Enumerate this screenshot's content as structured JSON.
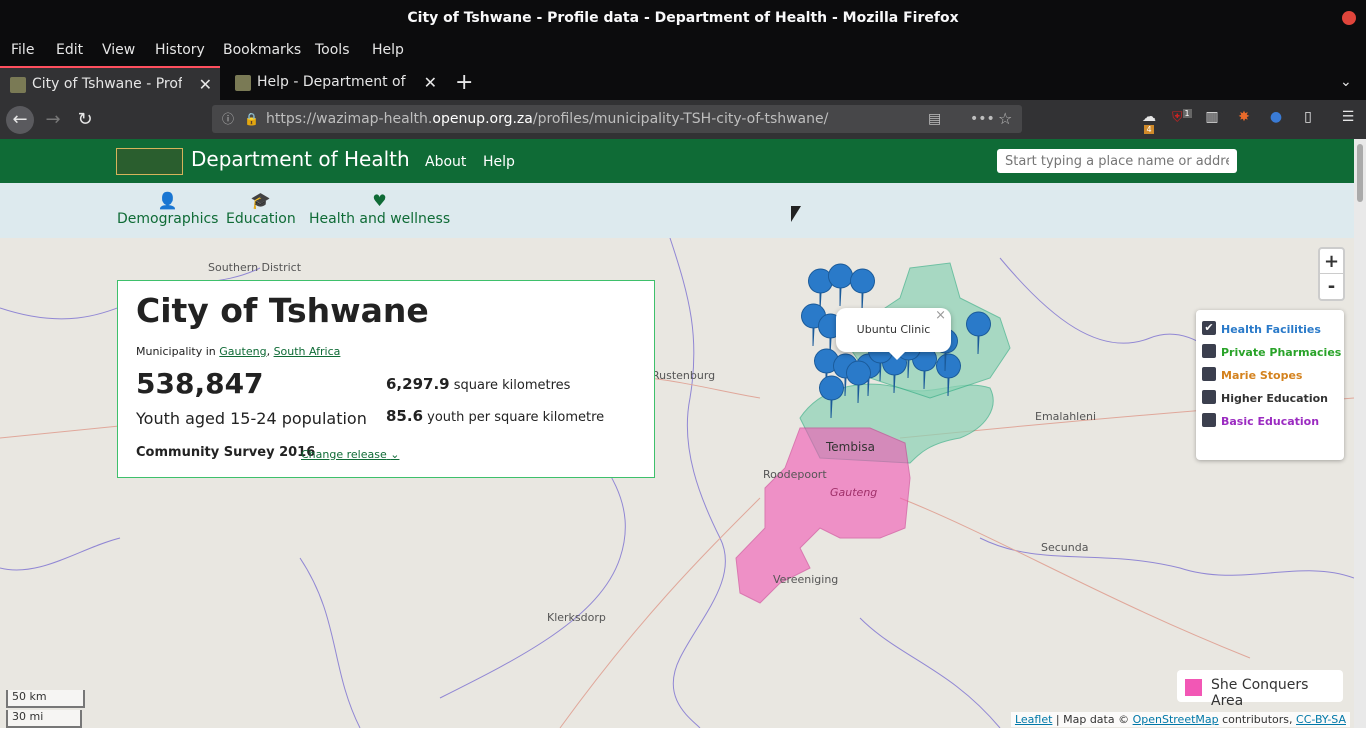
{
  "window": {
    "title": "City of Tshwane - Profile data - Department of Health - Mozilla Firefox"
  },
  "menu": [
    "File",
    "Edit",
    "View",
    "History",
    "Bookmarks",
    "Tools",
    "Help"
  ],
  "tabs": [
    {
      "label": "City of Tshwane - Profile",
      "active": true
    },
    {
      "label": "Help - Department of Hea",
      "active": false
    }
  ],
  "urlbar": {
    "prefix": "https://wazimap-health.",
    "domain": "openup.org.za",
    "path": "/profiles/municipality-TSH-city-of-tshwane/"
  },
  "toolbar_badges": {
    "badge_a": "4",
    "badge_b": "1"
  },
  "site": {
    "brand": "Department of Health",
    "nav": [
      "About",
      "Help"
    ],
    "search_placeholder": "Start typing a place name or address..."
  },
  "subnav": [
    {
      "label": "Demographics",
      "icon": "person-icon"
    },
    {
      "label": "Education",
      "icon": "graduation-cap-icon"
    },
    {
      "label": "Health and wellness",
      "icon": "heartbeat-icon"
    }
  ],
  "profile": {
    "name": "City of Tshwane",
    "geo_prefix": "Municipality in",
    "geo_links": [
      "Gauteng",
      "South Africa"
    ],
    "big_number": "538,847",
    "big_desc": "Youth aged 15-24 population",
    "area_value": "6,297.9",
    "area_unit": "square kilometres",
    "density_value": "85.6",
    "density_unit": "youth per square kilometre",
    "release": "Community Survey 2016",
    "change_release": "Change release"
  },
  "map": {
    "labels": [
      "Southern District",
      "Rustenburg",
      "Tembisa",
      "Roodepoort",
      "Gauteng",
      "Vereeniging",
      "Emalahleni",
      "Secunda",
      "Klerksdorp"
    ],
    "popup": "Ubuntu Clinic",
    "zoom_in": "+",
    "zoom_out": "-",
    "layers": [
      {
        "label": "Health Facilities",
        "color": "#2a7ac9",
        "checked": true
      },
      {
        "label": "Private Pharmacies",
        "color": "#29a329",
        "checked": false
      },
      {
        "label": "Marie Stopes",
        "color": "#d4821e",
        "checked": false
      },
      {
        "label": "Higher Education",
        "color": "#333333",
        "checked": false
      },
      {
        "label": "Basic Education",
        "color": "#9b2bc1",
        "checked": false
      }
    ],
    "area_legend": {
      "label": "She Conquers Area",
      "color": "#f257b5"
    },
    "scale": {
      "km": "50 km",
      "mi": "30 mi"
    },
    "attribution": {
      "leaflet": "Leaflet",
      "text1": " | Map data © ",
      "osm": "OpenStreetMap",
      "text2": " contributors, ",
      "license": "CC-BY-SA"
    }
  }
}
